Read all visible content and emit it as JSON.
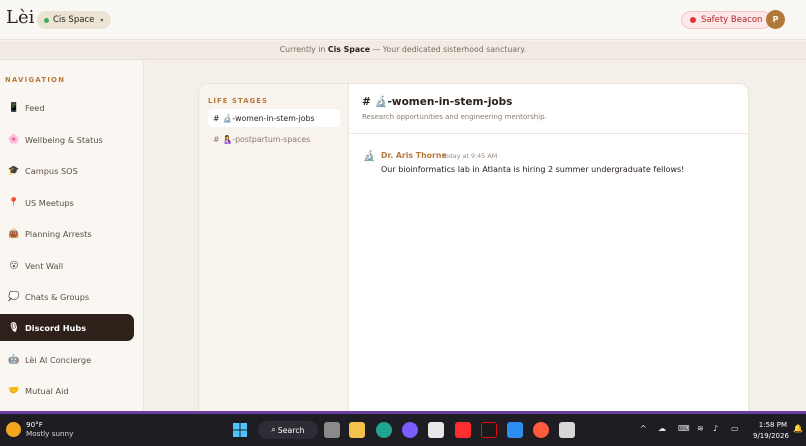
{
  "header": {
    "logo": "Lèi",
    "space_pill": {
      "label": "Cis Space",
      "chevron": "▾"
    },
    "beacon_label": "Safety Beacon",
    "avatar_initial": "P"
  },
  "banner": {
    "prefix": "Currently in ",
    "space": "Cis Space",
    "suffix": " — Your dedicated sisterhood sanctuary."
  },
  "sidebar": {
    "heading": "NAVIGATION",
    "items": [
      {
        "label": "Feed",
        "icon": "📱",
        "active": false
      },
      {
        "label": "Wellbeing & Status",
        "icon": "🌸",
        "active": false
      },
      {
        "label": "Campus SOS",
        "icon": "🎓",
        "active": false
      },
      {
        "label": "US Meetups",
        "icon": "📍",
        "active": false
      },
      {
        "label": "Planning Arrests",
        "icon": "👜",
        "active": false
      },
      {
        "label": "Vent Wall",
        "icon": "😮",
        "active": false
      },
      {
        "label": "Chats & Groups",
        "icon": "💭",
        "active": false
      },
      {
        "label": "Discord Hubs",
        "icon": "🎙",
        "active": true
      },
      {
        "label": "Lèi AI Concierge",
        "icon": "🤖",
        "active": false
      },
      {
        "label": "Mutual Aid",
        "icon": "🤝",
        "active": false
      }
    ]
  },
  "channels": {
    "heading": "LIFE STAGES",
    "items": [
      {
        "hash": "#",
        "icon": "🔬",
        "label": "-women-in-stem-jobs",
        "active": true
      },
      {
        "hash": "#",
        "icon": "🤱",
        "label": "-postpartum-spaces",
        "active": false
      }
    ]
  },
  "chat": {
    "title": "# 🔬-women-in-stem-jobs",
    "description": "Research opportunities and engineering mentorship.",
    "messages": [
      {
        "icon": "🔬",
        "author": "Dr. Aris Thorne",
        "time": "Today at 9:45 AM",
        "text": "Our bioinformatics lab in Atlanta is hiring 2 summer undergraduate fellows!"
      }
    ]
  },
  "taskbar": {
    "weather_temp": "90°F",
    "weather_desc": "Mostly sunny",
    "search_label": "Search",
    "clock_time": "1:58 PM",
    "clock_date": "9/19/2026"
  },
  "colors": {
    "accent": "#b47a3b",
    "active_nav": "#2d211a",
    "beacon": "#e0333c",
    "taskbar_line": "#6b3fa0"
  }
}
